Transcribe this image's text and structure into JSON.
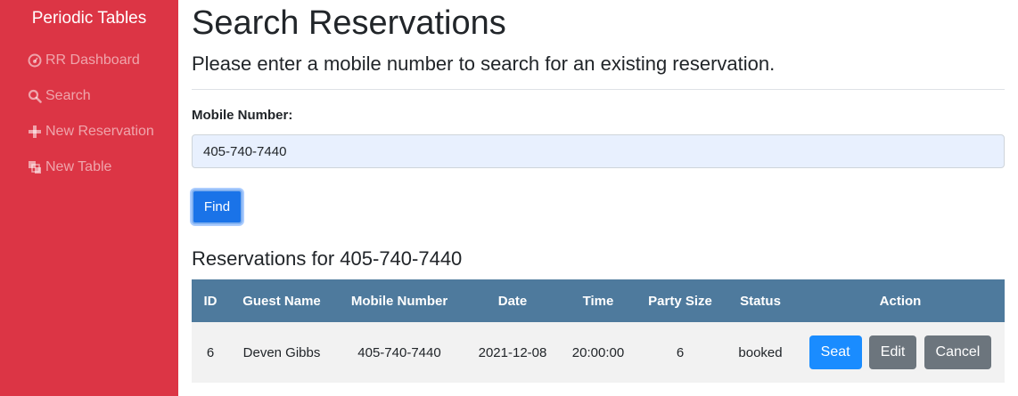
{
  "sidebar": {
    "brand": "Periodic Tables",
    "items": [
      {
        "label": "RR Dashboard",
        "icon": "dashboard-icon"
      },
      {
        "label": "Search",
        "icon": "search-icon"
      },
      {
        "label": "New Reservation",
        "icon": "plus-icon"
      },
      {
        "label": "New Table",
        "icon": "layers-icon"
      }
    ],
    "color": "#dc3545"
  },
  "page": {
    "title": "Search Reservations",
    "subtitle": "Please enter a mobile number to search for an existing reservation."
  },
  "form": {
    "label": "Mobile Number:",
    "value": "405-740-7440",
    "find_label": "Find"
  },
  "results": {
    "heading": "Reservations for 405-740-7440",
    "columns": [
      "ID",
      "Guest Name",
      "Mobile Number",
      "Date",
      "Time",
      "Party Size",
      "Status",
      "Action"
    ],
    "rows": [
      {
        "id": "6",
        "guest_name": "Deven Gibbs",
        "mobile_number": "405-740-7440",
        "date": "2021-12-08",
        "time": "20:00:00",
        "party_size": "6",
        "status": "booked",
        "actions": {
          "seat": "Seat",
          "edit": "Edit",
          "cancel": "Cancel"
        }
      }
    ],
    "header_color": "#4e7a9d"
  }
}
